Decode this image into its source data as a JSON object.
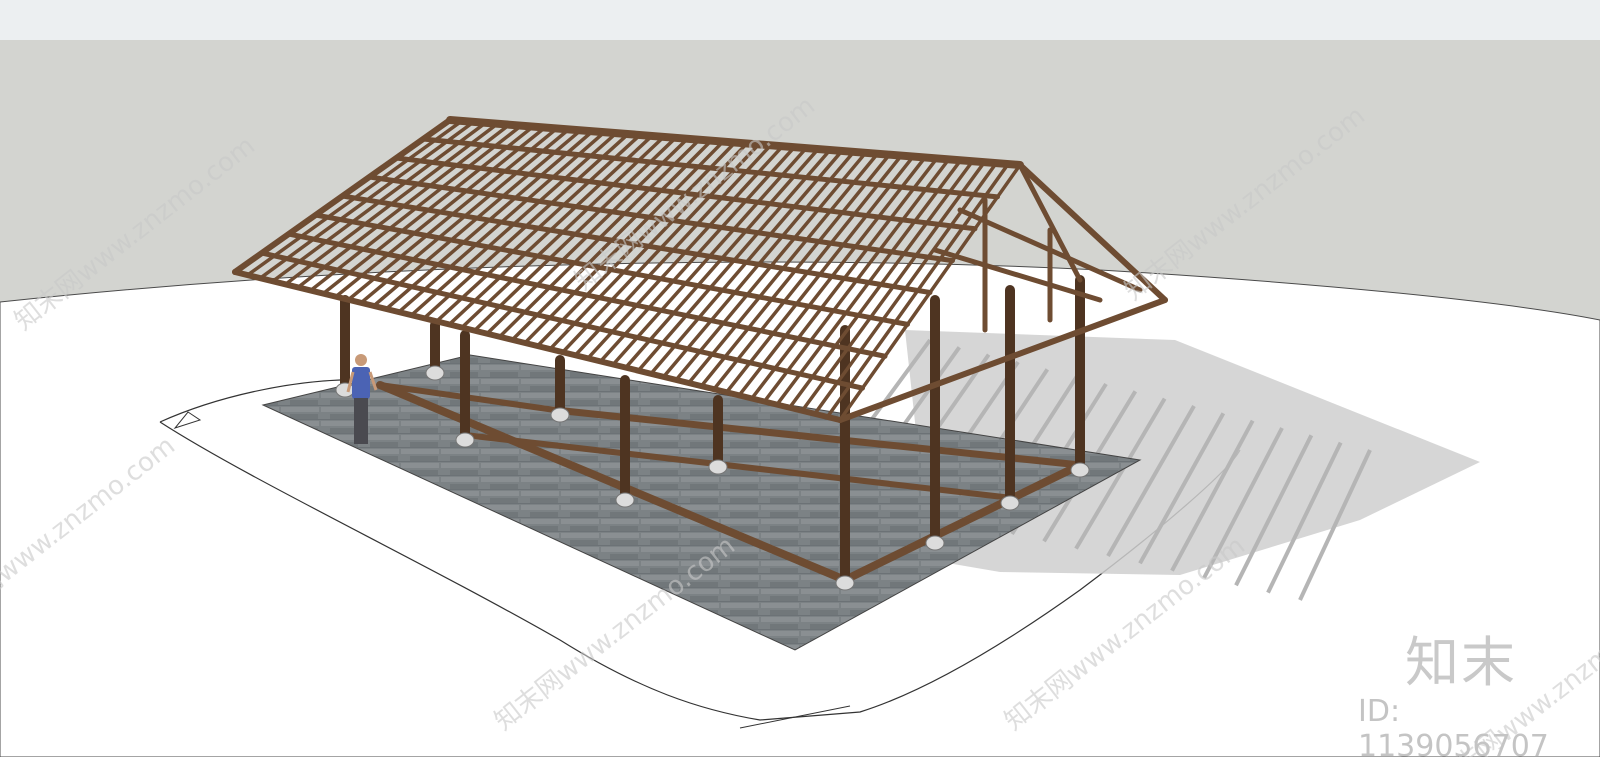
{
  "watermark": {
    "brand": "知末",
    "id_text": "ID: 1139056707",
    "diagonal_text": "知末网www.znzmo.com"
  },
  "colors": {
    "sky_band": "#eceff1",
    "backdrop": "#d3d4d0",
    "ground": "#ffffff",
    "paving": "#7f8487",
    "timber": "#6e4c32",
    "timber_dark": "#4e3421",
    "shadow": "#c6c6c6",
    "watermark": "#c9c9c9"
  }
}
